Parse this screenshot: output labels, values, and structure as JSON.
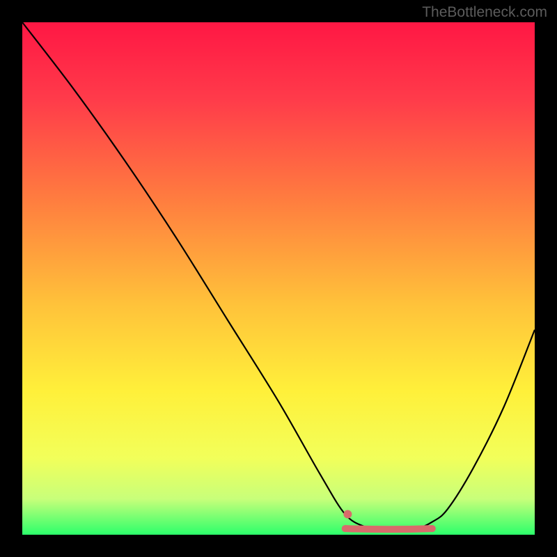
{
  "watermark": "TheBottleneck.com",
  "chart_data": {
    "type": "line",
    "title": "",
    "xlabel": "",
    "ylabel": "",
    "xlim": [
      0,
      100
    ],
    "ylim": [
      0,
      100
    ],
    "gradient_stops": [
      {
        "offset": 0,
        "color": "#ff1744"
      },
      {
        "offset": 15,
        "color": "#ff3b4a"
      },
      {
        "offset": 35,
        "color": "#ff7e3f"
      },
      {
        "offset": 55,
        "color": "#ffc23a"
      },
      {
        "offset": 72,
        "color": "#fff03a"
      },
      {
        "offset": 85,
        "color": "#f2ff5a"
      },
      {
        "offset": 93,
        "color": "#c8ff7a"
      },
      {
        "offset": 100,
        "color": "#2cff6b"
      }
    ],
    "curve": [
      {
        "x": 0,
        "y": 100
      },
      {
        "x": 10,
        "y": 87
      },
      {
        "x": 20,
        "y": 73
      },
      {
        "x": 30,
        "y": 58
      },
      {
        "x": 40,
        "y": 42
      },
      {
        "x": 50,
        "y": 26
      },
      {
        "x": 58,
        "y": 12
      },
      {
        "x": 63,
        "y": 4
      },
      {
        "x": 67,
        "y": 1.5
      },
      {
        "x": 70,
        "y": 1
      },
      {
        "x": 73,
        "y": 1
      },
      {
        "x": 77,
        "y": 1.2
      },
      {
        "x": 80,
        "y": 2.5
      },
      {
        "x": 83,
        "y": 5
      },
      {
        "x": 88,
        "y": 13
      },
      {
        "x": 94,
        "y": 25
      },
      {
        "x": 100,
        "y": 40
      }
    ],
    "marker_color": "#d86b6b",
    "optimal_segment": {
      "x_start": 63,
      "x_end": 80,
      "y": 1.2
    },
    "marker_end_point": {
      "x": 63.5,
      "y": 4
    }
  }
}
